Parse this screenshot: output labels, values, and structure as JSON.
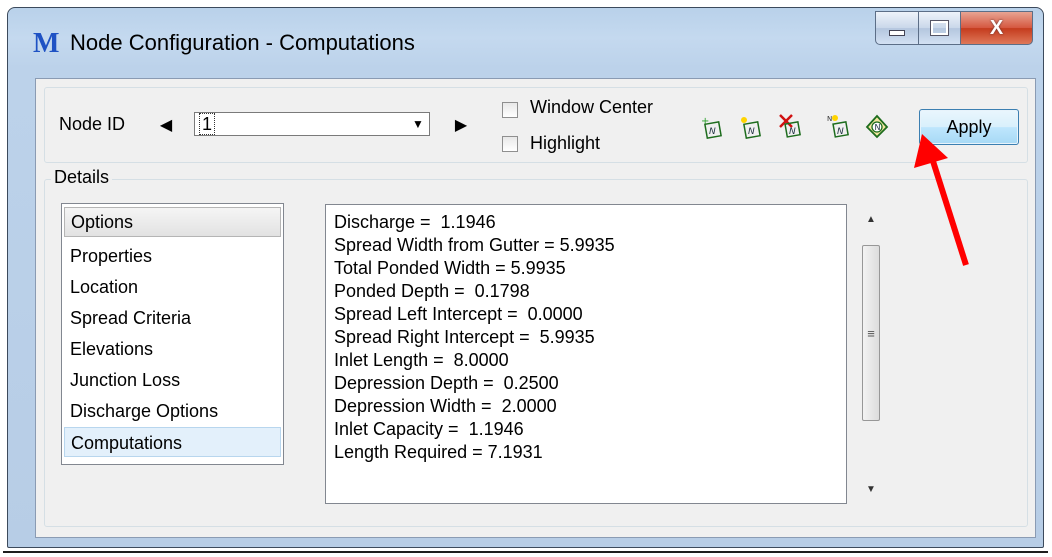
{
  "window": {
    "title": "Node Configuration - Computations",
    "app_icon_glyph": "M",
    "controls": {
      "minimize_icon": "minimize-icon",
      "maximize_icon": "maximize-icon",
      "close_glyph": "X"
    }
  },
  "toolbar": {
    "node_id_label": "Node ID",
    "prev_glyph": "◀",
    "next_glyph": "▶",
    "node_id_value": "1",
    "window_center_label": "Window Center",
    "highlight_label": "Highlight",
    "tools": [
      "add-node-icon",
      "new-node-icon",
      "delete-node-icon",
      "rename-node-icon",
      "node-report-icon"
    ],
    "apply_label": "Apply"
  },
  "details": {
    "legend": "Details",
    "options_header": "Options",
    "options": [
      "Properties",
      "Location",
      "Spread Criteria",
      "Elevations",
      "Junction Loss",
      "Discharge Options",
      "Computations"
    ],
    "selected_option": "Computations"
  },
  "computations": [
    "Discharge =  1.1946",
    "Spread Width from Gutter = 5.9935",
    "Total Ponded Width = 5.9935",
    "Ponded Depth =  0.1798",
    "Spread Left Intercept =  0.0000",
    "Spread Right Intercept =  5.9935",
    "Inlet Length =  8.0000",
    "Depression Depth =  0.2500",
    "Depression Width =  2.0000",
    "Inlet Capacity =  1.1946",
    "Length Required = 7.1931"
  ],
  "scrollbar": {
    "up_glyph": "▲",
    "down_glyph": "▼",
    "grip_glyph": "≡"
  },
  "colors": {
    "annotation_arrow": "#ff0000",
    "title_icon": "#1f52c4",
    "selection": "#e3f0fb"
  }
}
